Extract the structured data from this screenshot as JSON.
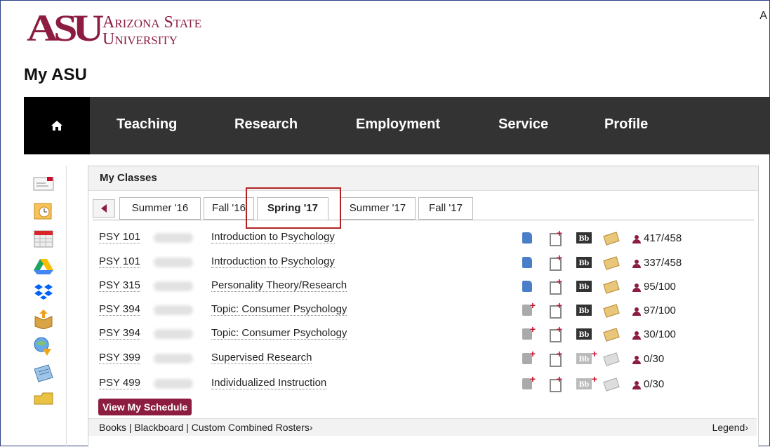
{
  "brand": {
    "logo_mark": "ASU",
    "line1": "Arizona State",
    "line2": "University",
    "colors": {
      "maroon": "#8c1d40",
      "gold": "#ffc627"
    }
  },
  "top_right": "A",
  "page_title": "My ASU",
  "nav": {
    "home_icon": "home-icon",
    "items": [
      "Teaching",
      "Research",
      "Employment",
      "Service",
      "Profile"
    ]
  },
  "sidebar": {
    "icons": [
      "webmail-icon",
      "calendar-outlook-icon",
      "calendar-icon",
      "google-drive-icon",
      "dropbox-icon",
      "box-icon",
      "search-globe-icon",
      "news-icon",
      "folder-icon"
    ]
  },
  "classes": {
    "header": "My Classes",
    "tabs": [
      "Summer '16",
      "Fall '16",
      "Spring '17",
      "Summer '17",
      "Fall '17"
    ],
    "active_tab": "Spring '17",
    "rows": [
      {
        "code": "PSY 101",
        "title": "Introduction to Psychology",
        "book": "blue",
        "bb": "active",
        "mail": "active",
        "enrollment": "417/458"
      },
      {
        "code": "PSY 101",
        "title": "Introduction to Psychology",
        "book": "blue",
        "bb": "active",
        "mail": "active",
        "enrollment": "337/458"
      },
      {
        "code": "PSY 315",
        "title": "Personality Theory/Research",
        "book": "blue",
        "bb": "active",
        "mail": "active",
        "enrollment": "95/100"
      },
      {
        "code": "PSY 394",
        "title": "Topic: Consumer Psychology",
        "book": "add",
        "bb": "active",
        "mail": "active",
        "enrollment": "97/100"
      },
      {
        "code": "PSY 394",
        "title": "Topic: Consumer Psychology",
        "book": "add",
        "bb": "active",
        "mail": "active",
        "enrollment": "30/100"
      },
      {
        "code": "PSY 399",
        "title": "Supervised Research",
        "book": "add",
        "bb": "add",
        "mail": "inactive",
        "enrollment": "0/30"
      },
      {
        "code": "PSY 499",
        "title": "Individualized Instruction",
        "book": "add",
        "bb": "add",
        "mail": "inactive",
        "enrollment": "0/30"
      }
    ],
    "bb_label": "Bb",
    "plus": "+",
    "schedule_button": "View My Schedule",
    "footer_links": "Books | Blackboard | Custom Combined Rosters›",
    "legend": "Legend›"
  }
}
